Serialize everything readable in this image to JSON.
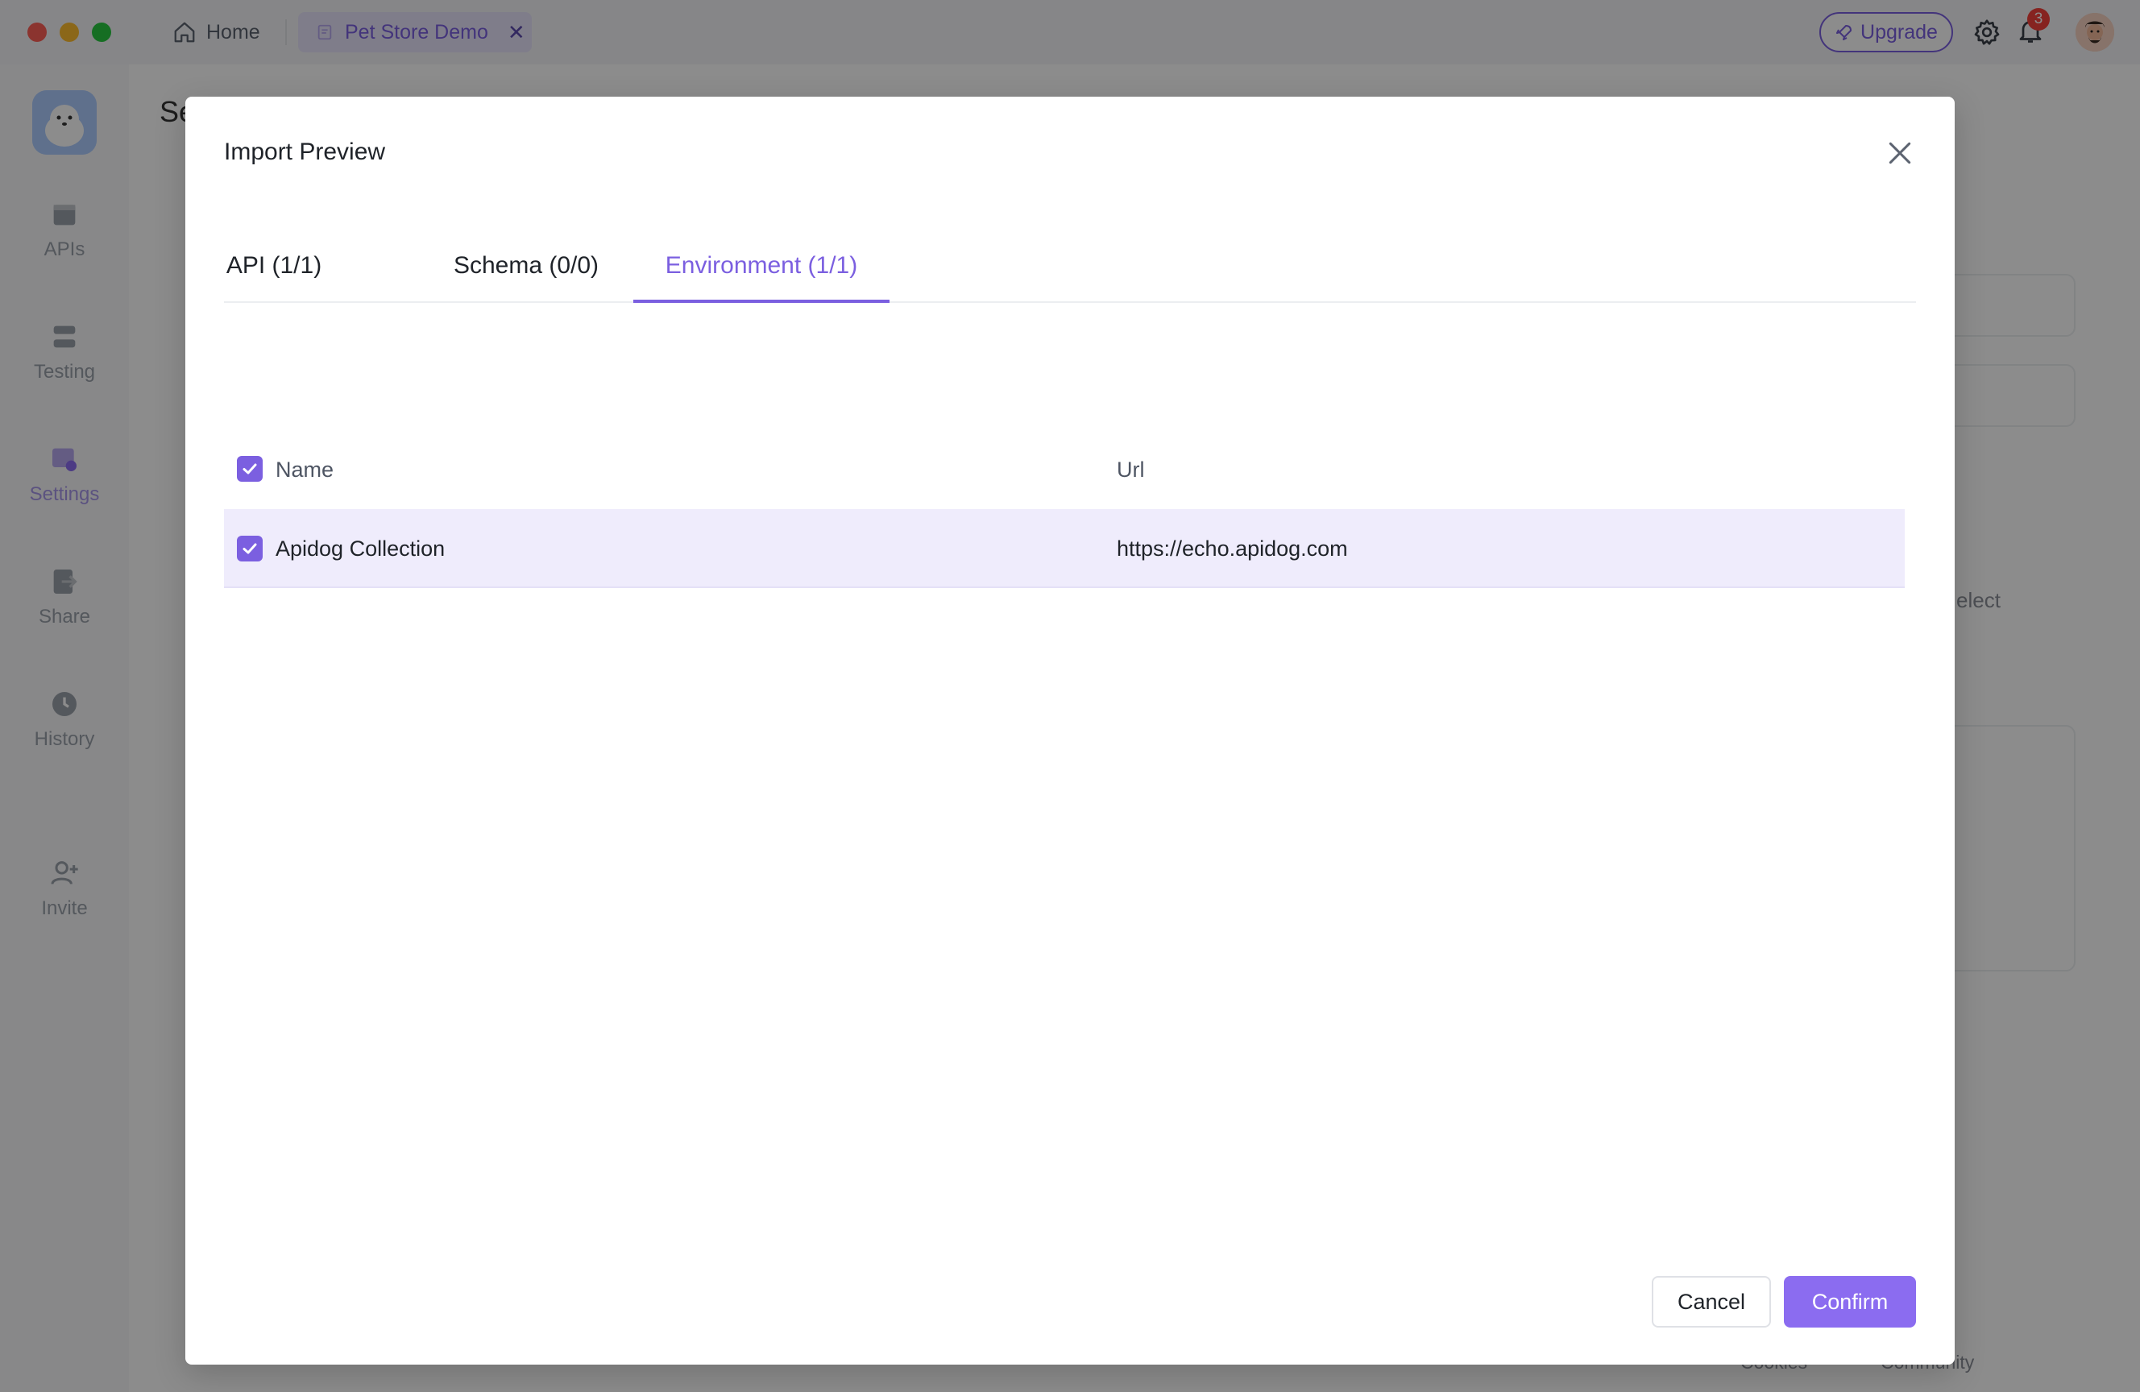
{
  "titlebar": {
    "home_label": "Home",
    "project_tab_label": "Pet Store Demo",
    "upgrade_label": "Upgrade",
    "notification_count": "3",
    "accent_color": "#7b5fe0"
  },
  "sidebar": {
    "items": [
      {
        "label": "APIs",
        "icon": "apis-icon"
      },
      {
        "label": "Testing",
        "icon": "testing-icon"
      },
      {
        "label": "Settings",
        "icon": "settings-icon"
      },
      {
        "label": "Share",
        "icon": "share-icon"
      },
      {
        "label": "History",
        "icon": "history-icon"
      },
      {
        "label": "Invite",
        "icon": "invite-icon"
      }
    ]
  },
  "background": {
    "title_fragment": "Se",
    "select_fragment": "elect",
    "footer_cookies": "Cookies",
    "footer_community": "Community"
  },
  "modal": {
    "title": "Import Preview",
    "tabs": [
      {
        "label": "API (1/1)",
        "active": false
      },
      {
        "label": "Schema (0/0)",
        "active": false
      },
      {
        "label": "Environment (1/1)",
        "active": true
      }
    ],
    "table": {
      "columns": [
        "Name",
        "Url"
      ],
      "rows": [
        {
          "name": "Apidog Collection",
          "url": "https://echo.apidog.com",
          "checked": true
        }
      ]
    },
    "cancel_label": "Cancel",
    "confirm_label": "Confirm"
  }
}
